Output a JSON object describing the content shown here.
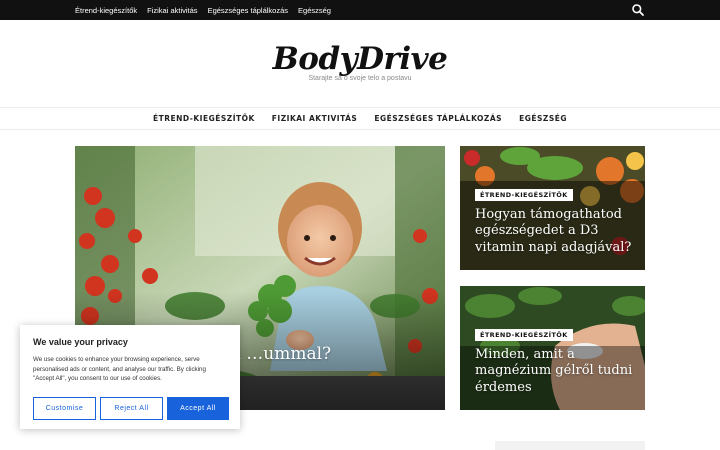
{
  "topbar": {
    "links": [
      "Étrend-kiegészítők",
      "Fizikai aktivitás",
      "Egészséges táplálkozás",
      "Egészség"
    ],
    "search_icon": "search-icon"
  },
  "header": {
    "logo": "BodyDrive",
    "tagline": "Starajte sa o svoje telo a postavu"
  },
  "mainnav": {
    "items": [
      "ÉTREND-KIEGÉSZÍTŐK",
      "FIZIKAI AKTIVITÁS",
      "EGÉSZSÉGES TÁPLÁLKOZÁS",
      "EGÉSZSÉG"
    ]
  },
  "featured": {
    "title": "…tod gyermekeid …ummal?"
  },
  "side_cards": [
    {
      "category": "ÉTREND-KIEGÉSZÍTŐK",
      "title": "Hogyan támogathatod egészségedet a D3 vitamin napi adagjával?"
    },
    {
      "category": "ÉTREND-KIEGÉSZÍTŐK",
      "title": "Minden, amit a magnézium gélről tudni érdemes"
    }
  ],
  "cookie": {
    "title": "We value your privacy",
    "text": "We use cookies to enhance your browsing experience, serve personalised ads or content, and analyse our traffic. By clicking \"Accept All\", you consent to our use of cookies.",
    "customise": "Customise",
    "reject": "Reject All",
    "accept": "Accept All",
    "accent": "#1863dc"
  }
}
